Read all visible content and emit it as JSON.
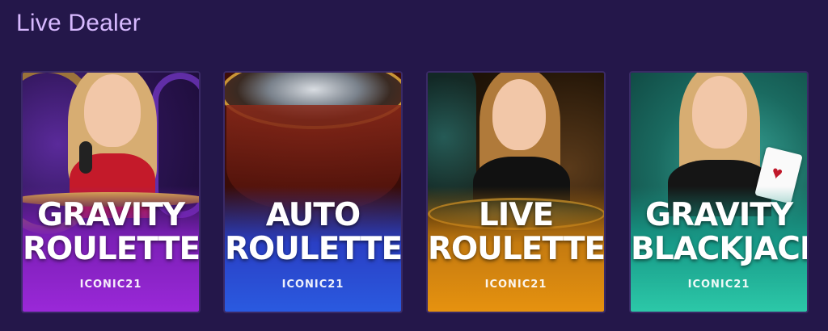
{
  "section": {
    "title": "Live Dealer"
  },
  "games": [
    {
      "title_line1": "GRAVITY",
      "title_line2": "ROULETTE",
      "provider": "ICONIC21",
      "accent": "#8a1fc4"
    },
    {
      "title_line1": "AUTO",
      "title_line2": "ROULETTE",
      "provider": "ICONIC21",
      "accent": "#2a4fd6"
    },
    {
      "title_line1": "LIVE",
      "title_line2": "ROULETTE",
      "provider": "ICONIC21",
      "accent": "#d6860f"
    },
    {
      "title_line1": "GRAVITY",
      "title_line2": "BLACKJACK",
      "provider": "ICONIC21",
      "accent": "#1fb59e"
    }
  ]
}
